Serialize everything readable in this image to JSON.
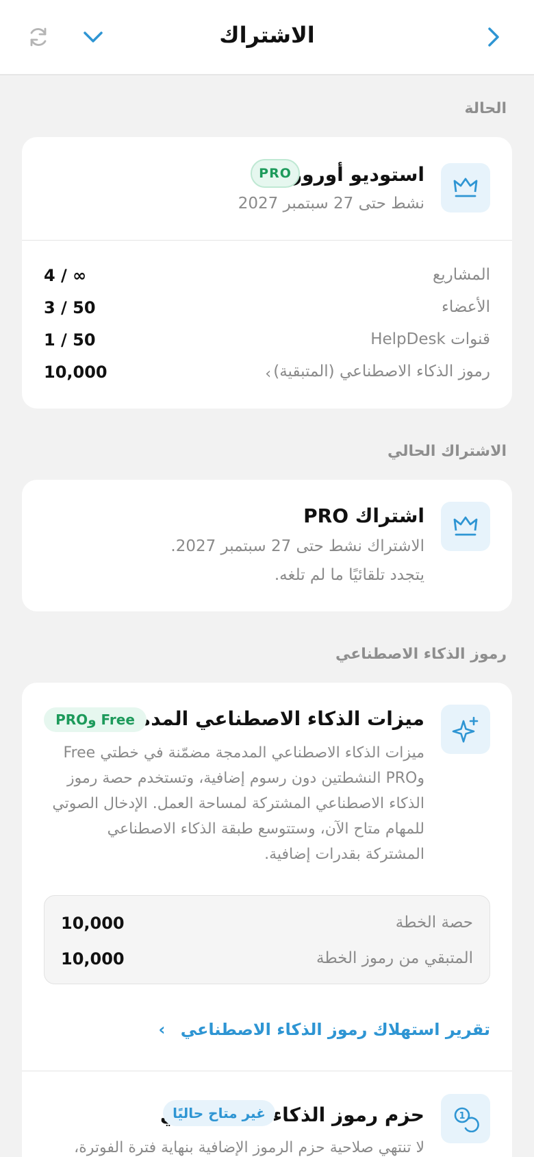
{
  "header": {
    "title": "الاشتراك",
    "back_icon": "chevron-right-icon",
    "dropdown_icon": "chevron-down-icon",
    "refresh_icon": "refresh-icon"
  },
  "colors": {
    "accent": "#2e95d3",
    "green": "#1d9a5b",
    "background": "#f2f2f2"
  },
  "status": {
    "section_title": "الحالة",
    "workspace_name": "استوديو أورورا",
    "badge": "PRO",
    "active_until": "نشط حتى 27 سبتمبر 2027",
    "icon": "crown-icon",
    "usage": [
      {
        "label": "المشاريع",
        "value": "4 / ∞"
      },
      {
        "label": "الأعضاء",
        "value": "3 / 50"
      },
      {
        "label": "قنوات HelpDesk",
        "value": "1 / 50"
      },
      {
        "label": "رموز الذكاء الاصطناعي (المتبقية)",
        "value": "10,000",
        "chevron": "›"
      }
    ]
  },
  "current": {
    "section_title": "الاشتراك الحالي",
    "title": "اشتراك PRO",
    "line1": "الاشتراك نشط حتى 27 سبتمبر 2027.",
    "line2": "يتجدد تلقائيًا ما لم تلغه.",
    "icon": "crown-icon"
  },
  "ai": {
    "section_title": "رموز الذكاء الاصطناعي",
    "title": "ميزات الذكاء الاصطناعي المدمجة",
    "badge": "Free وPRO",
    "icon": "sparkle-icon",
    "desc_lines": [
      "ميزات الذكاء الاصطناعي المدمجة مضمّنة في خطتي Free",
      "وPRO النشطتين دون رسوم إضافية، وتستخدم حصة رموز",
      "الذكاء الاصطناعي المشتركة لمساحة العمل. الإدخال الصوتي",
      "للمهام متاح الآن، وستتوسع طبقة الذكاء الاصطناعي",
      "المشتركة بقدرات إضافية."
    ],
    "quota": [
      {
        "label": "حصة الخطة",
        "value": "10,000"
      },
      {
        "label": "المتبقي من رموز الخطة",
        "value": "10,000"
      }
    ],
    "report_link": "تقرير استهلاك رموز الذكاء الاصطناعي",
    "report_chevron": "›",
    "packs_title": "حزم رموز الذكاء الاصطناعي",
    "packs_badge": "غير متاح حاليًا",
    "packs_icon": "token-coin-icon",
    "packs_desc": "لا تنتهي صلاحية حزم الرموز الإضافية بنهاية فترة الفوترة،"
  }
}
